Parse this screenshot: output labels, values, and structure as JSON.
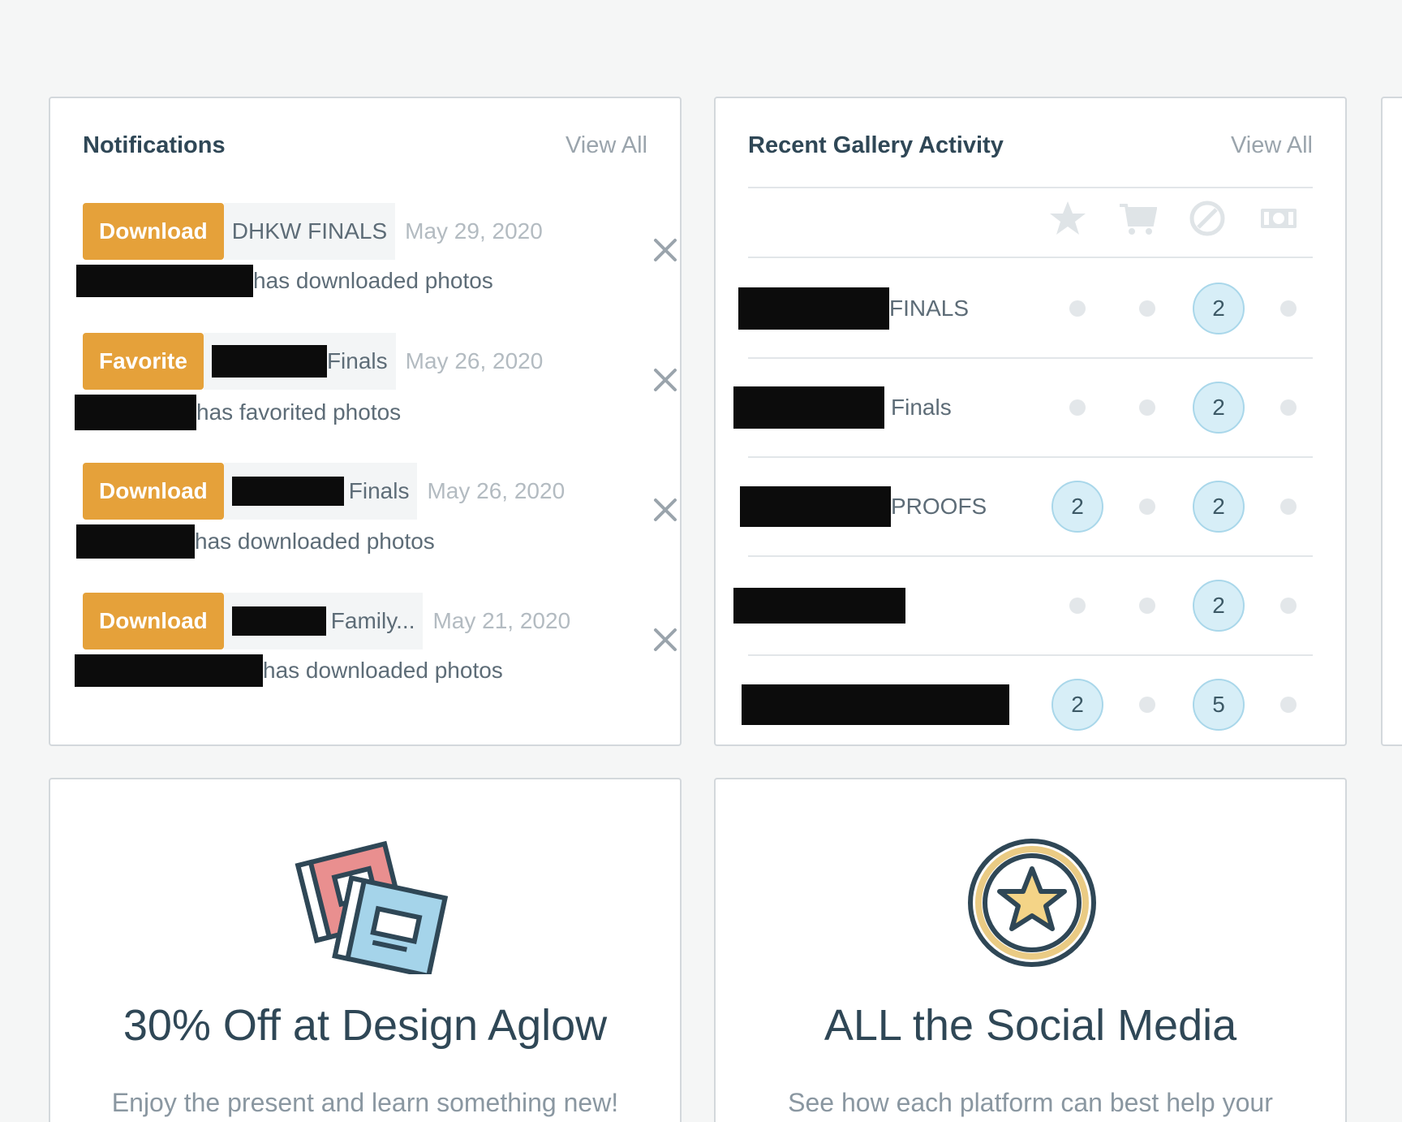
{
  "notifications": {
    "title": "Notifications",
    "view_all": "View All",
    "items": [
      {
        "type": "Download",
        "gallery": "DHKW FINALS",
        "date": "May 29, 2020",
        "message": "has downloaded photos"
      },
      {
        "type": "Favorite",
        "gallery": "Finals",
        "date": "May 26, 2020",
        "message": "has favorited photos"
      },
      {
        "type": "Download",
        "gallery": "Finals",
        "date": "May 26, 2020",
        "message": "has downloaded photos"
      },
      {
        "type": "Download",
        "gallery": "Family...",
        "date": "May 21, 2020",
        "message": "has downloaded photos"
      }
    ]
  },
  "gallery_activity": {
    "title": "Recent Gallery Activity",
    "view_all": "View All",
    "columns": [
      "star-icon",
      "cart-icon",
      "blocked-icon",
      "money-icon"
    ],
    "rows": [
      {
        "name": "FINALS",
        "favorites": null,
        "orders": null,
        "blocked": "2",
        "payments": null
      },
      {
        "name": "Finals",
        "favorites": null,
        "orders": null,
        "blocked": "2",
        "payments": null
      },
      {
        "name": "PROOFS",
        "favorites": "2",
        "orders": null,
        "blocked": "2",
        "payments": null
      },
      {
        "name": "",
        "favorites": null,
        "orders": null,
        "blocked": "2",
        "payments": null
      },
      {
        "name": "",
        "favorites": "2",
        "orders": null,
        "blocked": "5",
        "payments": null
      }
    ]
  },
  "promos": [
    {
      "title": "30% Off at Design Aglow",
      "subtitle": "Enjoy the present and learn something new!",
      "icon": "photo-albums-icon"
    },
    {
      "title": "ALL the Social Media",
      "subtitle": "See how each platform can best help your",
      "icon": "star-badge-icon"
    }
  ],
  "colors": {
    "accent": "#e5a13a",
    "count_bg": "#d7eef7",
    "count_border": "#a9d7ea",
    "text_dark": "#2f4756",
    "text_muted": "#b3bbc1"
  }
}
